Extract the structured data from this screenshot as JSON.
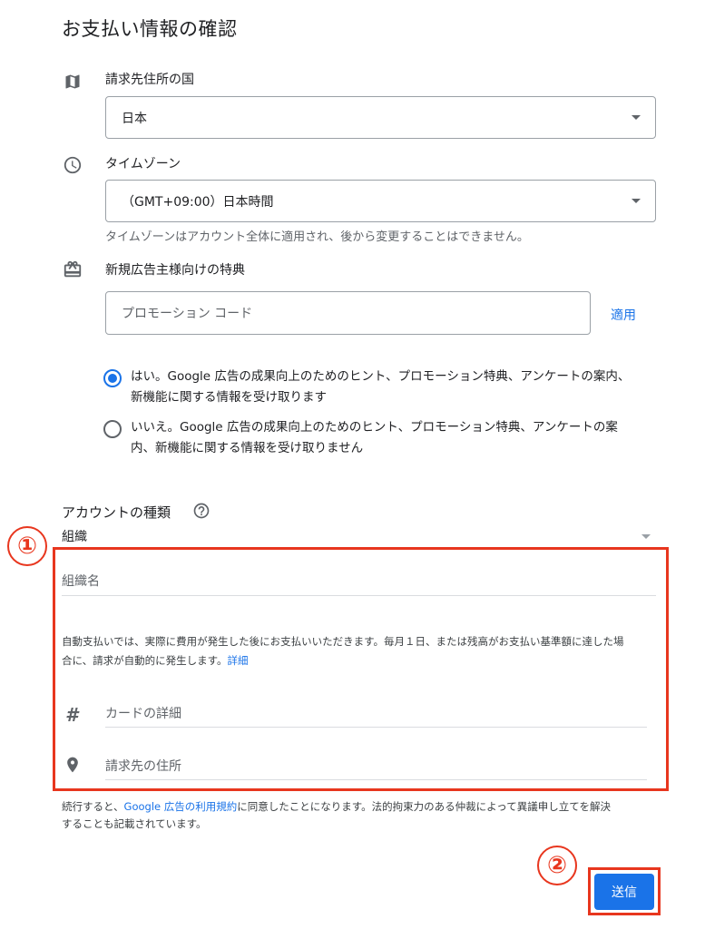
{
  "page": {
    "title": "お支払い情報の確認"
  },
  "billing_country": {
    "label": "請求先住所の国",
    "selected": "日本",
    "icon": "map-icon"
  },
  "timezone": {
    "label": "タイムゾーン",
    "selected": "（GMT+09:00）日本時間",
    "helper": "タイムゾーンはアカウント全体に適用され、後から変更することはできません。",
    "icon": "clock-icon"
  },
  "promotion": {
    "label": "新規広告主様向けの特典",
    "placeholder": "プロモーション コード",
    "apply_label": "適用",
    "icon": "gift-icon"
  },
  "email_opt": {
    "yes_line1": "はい。Google 広告の成果向上のためのヒント、プロモーション特典、アンケートの案内、",
    "yes_line2": "新機能に関する情報を受け取ります",
    "no_line1": "いいえ。Google 広告の成果向上のためのヒント、プロモーション特典、アンケートの案",
    "no_line2": "内、新機能に関する情報を受け取りません",
    "selected": "yes"
  },
  "account_type": {
    "label": "アカウントの種類",
    "selected": "組織",
    "org_name_placeholder": "組織名",
    "auto_pay_line1": "自動支払いでは、実際に費用が発生した後にお支払いいただきます。毎月１日、または残高がお支払い基準額に達した場",
    "auto_pay_line2": "合に、請求が自動的に発生します。",
    "details_link": "詳細",
    "card_placeholder": "カードの詳細",
    "address_placeholder": "請求先の住所"
  },
  "terms": {
    "line1_pre": "続行すると、",
    "link": "Google 広告の利用規約",
    "line1_post": "に同意したことになります。法的拘束力のある仲裁によって異議申し立てを解決",
    "line2": "することも記載されています。"
  },
  "submit_label": "送信",
  "annotations": {
    "badge1": "①",
    "badge2": "②"
  },
  "colors": {
    "accent": "#1a73e8",
    "annotation_red": "#e8361e"
  }
}
